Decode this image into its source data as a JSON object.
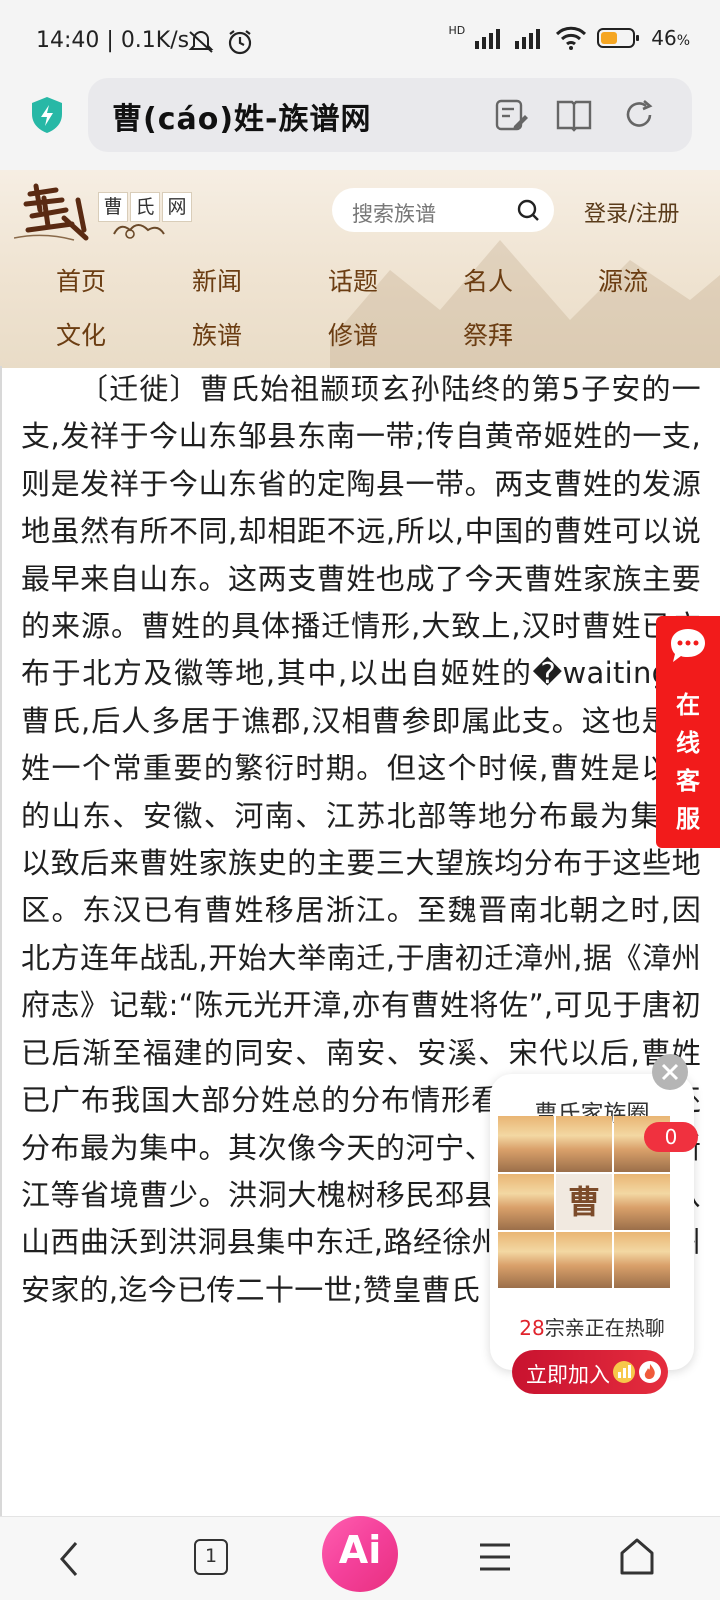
{
  "status_bar": {
    "time": "14:40",
    "speed": "0.1K/s",
    "battery": "46",
    "battery_unit": "%",
    "network": "HD"
  },
  "browser": {
    "page_title": "曹(cáo)姓-族谱网",
    "icons": [
      "shield-check-icon",
      "edit-note-icon",
      "reader-book-icon",
      "refresh-icon"
    ]
  },
  "site": {
    "logo_chars": [
      "曹",
      "氏",
      "网"
    ],
    "search_placeholder": "搜索族谱",
    "login_label": "登录/注册",
    "nav": [
      "首页",
      "新闻",
      "话题",
      "名人",
      "源流",
      "文化",
      "族谱",
      "修谱",
      "祭拜"
    ]
  },
  "article": {
    "text": "〔迁徙〕曹氏始祖颛顼玄孙陆终的第5子安的一支,发祥于今山东邹县东南一带;传自黄帝姬姓的一支,则是发祥于今山东省的定陶县一带。两支曹姓的发源地虽然有所不同,却相距不远,所以,中国的曹姓可以说最早来自山东。这两支曹姓也成了今天曹姓家族主要的来源。曹姓的具体播迁情形,大致上,汉时曹姓已广布于北方及徽等地,其中,以出自姬姓的�waiting国曹氏,后人多居于谯郡,汉相曹参即属此支。这也是曹姓一个常重要的繁衍时期。但这个时候,曹姓是以今的山东、安徽、河南、江苏北部等地分布最为集中,以致后来曹姓家族史的主要三大望族均分布于这些地区。东汉已有曹姓移居浙江。至魏晋南北朝之时,因北方连年战乱,开始大举南迁,于唐初迁漳州,据《漳州府志》记载:“陈元光开漳,亦有曹姓将佐”,可见于唐初已后渐至福建的同安、南安、安溪、宋代以后,曹姓已广布我国大部分姓总的分布情形看,历史上,曹姓还分布最为集中。其次像今天的河宁、甘肃、湖北、浙江等省境曹少。洪洞大槐树移民邳县曹氏一支中叶从山西曲沃到洪洞县集中东迁,路经徐州(彭城)后至邳州安家的,迄今已传二十一世;赞皇曹氏"
  },
  "customer_service": {
    "label": "在线客服"
  },
  "family_circle": {
    "title": "曹氏家族圈",
    "badge": "0",
    "center_char": "曹",
    "hot_count": "28",
    "hot_text": "宗亲正在热聊",
    "join_label": "立即加入"
  },
  "bottom_nav": {
    "tab_count": "1",
    "ai_label": "Ai"
  }
}
